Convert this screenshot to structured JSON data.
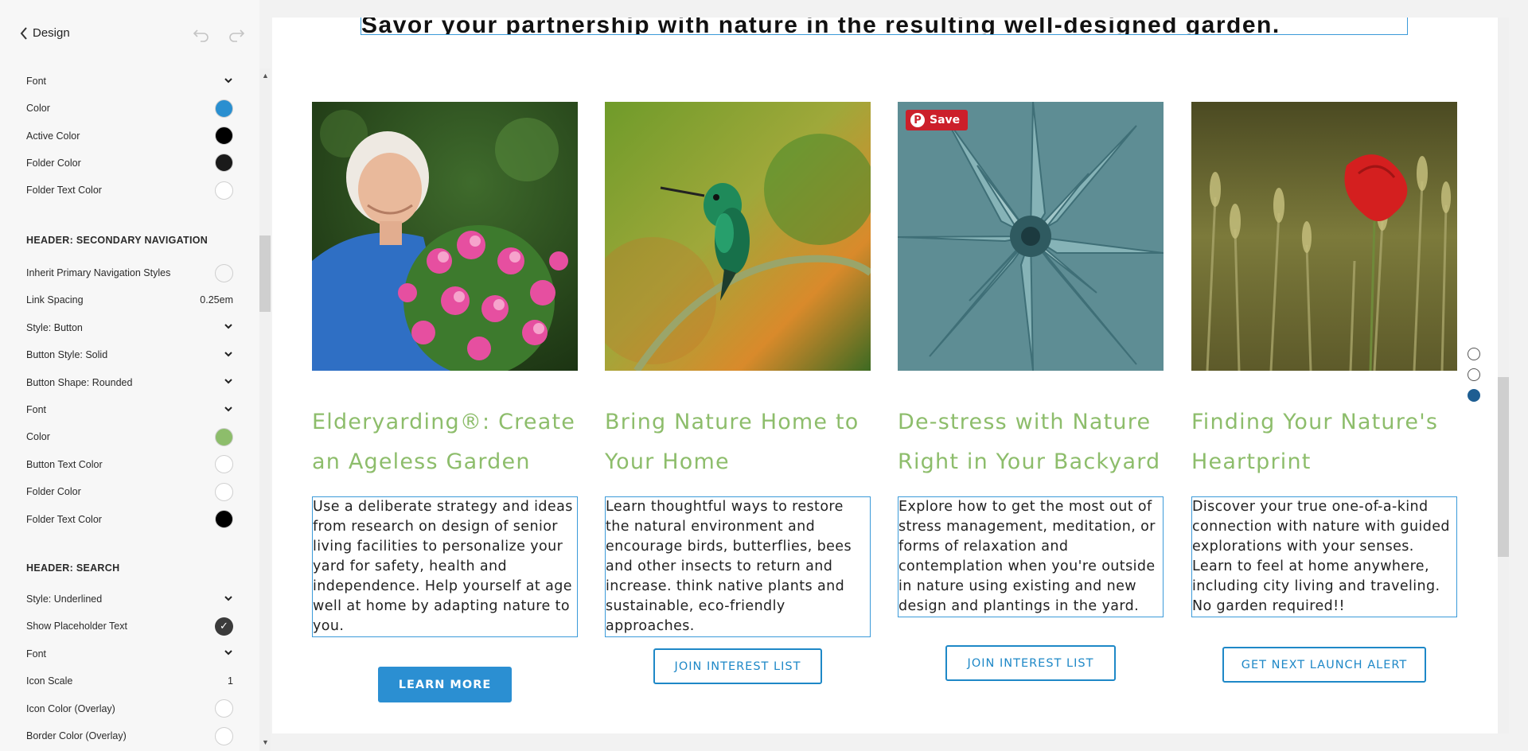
{
  "panel": {
    "back_label": "Design",
    "rows_a": [
      {
        "label": "Font",
        "kind": "chevron"
      },
      {
        "label": "Color",
        "kind": "swatch",
        "color": "#2a8fd0"
      },
      {
        "label": "Active Color",
        "kind": "swatch",
        "color": "#000000"
      },
      {
        "label": "Folder Color",
        "kind": "swatch",
        "color": "#1a1a1a"
      },
      {
        "label": "Folder Text Color",
        "kind": "swatch",
        "color": "#ffffff"
      }
    ],
    "section_secondary": "HEADER: SECONDARY NAVIGATION",
    "rows_b": [
      {
        "label": "Inherit Primary Navigation Styles",
        "kind": "toggle-off"
      },
      {
        "label": "Link Spacing",
        "kind": "value",
        "value": "0.25em"
      },
      {
        "label": "Style: Button",
        "kind": "chevron"
      },
      {
        "label": "Button Style: Solid",
        "kind": "chevron"
      },
      {
        "label": "Button Shape: Rounded",
        "kind": "chevron"
      },
      {
        "label": "Font",
        "kind": "chevron"
      },
      {
        "label": "Color",
        "kind": "swatch",
        "color": "#8dbd6b"
      },
      {
        "label": "Button Text Color",
        "kind": "swatch",
        "color": "#ffffff"
      },
      {
        "label": "Folder Color",
        "kind": "swatch",
        "color": "#ffffff"
      },
      {
        "label": "Folder Text Color",
        "kind": "swatch",
        "color": "#000000"
      }
    ],
    "section_search": "HEADER: SEARCH",
    "rows_c": [
      {
        "label": "Style: Underlined",
        "kind": "chevron"
      },
      {
        "label": "Show Placeholder Text",
        "kind": "check-on"
      },
      {
        "label": "Font",
        "kind": "chevron"
      },
      {
        "label": "Icon Scale",
        "kind": "value",
        "value": "1"
      },
      {
        "label": "Icon Color (Overlay)",
        "kind": "swatch",
        "color": "#ffffff"
      },
      {
        "label": "Border Color (Overlay)",
        "kind": "swatch",
        "color": "#ffffff"
      }
    ]
  },
  "canvas": {
    "headline": "Savor your partnership with nature in the resulting well-designed garden.",
    "pin_save_label": "Save",
    "cards": [
      {
        "title": "Elderyarding®: Create an Ageless Garden",
        "description": "Use a deliberate strategy and ideas from research on design of senior living facilities to personalize your yard for safety, health and independence. Help yourself at age well at home by adapting nature to you.",
        "button": "LEARN MORE"
      },
      {
        "title": "Bring Nature Home to Your Home",
        "description": "Learn thoughtful ways to restore the natural environment and encourage birds, butterflies, bees and other insects to return and increase. think native plants and sustainable, eco-friendly approaches.",
        "button": "JOIN INTEREST LIST"
      },
      {
        "title": "De-stress with Nature Right in Your Backyard",
        "description": "Explore how to get the most out of stress management, meditation, or forms of relaxation and contemplation when you're outside in nature using existing and new design and plantings in the yard.",
        "button": "JOIN INTEREST LIST"
      },
      {
        "title": "Finding Your Nature's Heartprint",
        "description": "Discover your true one-of-a-kind connection with nature with guided explorations with your senses. Learn to feel at home anywhere, including city living and traveling. No garden required!!",
        "button": "GET NEXT LAUNCH ALERT"
      }
    ]
  }
}
